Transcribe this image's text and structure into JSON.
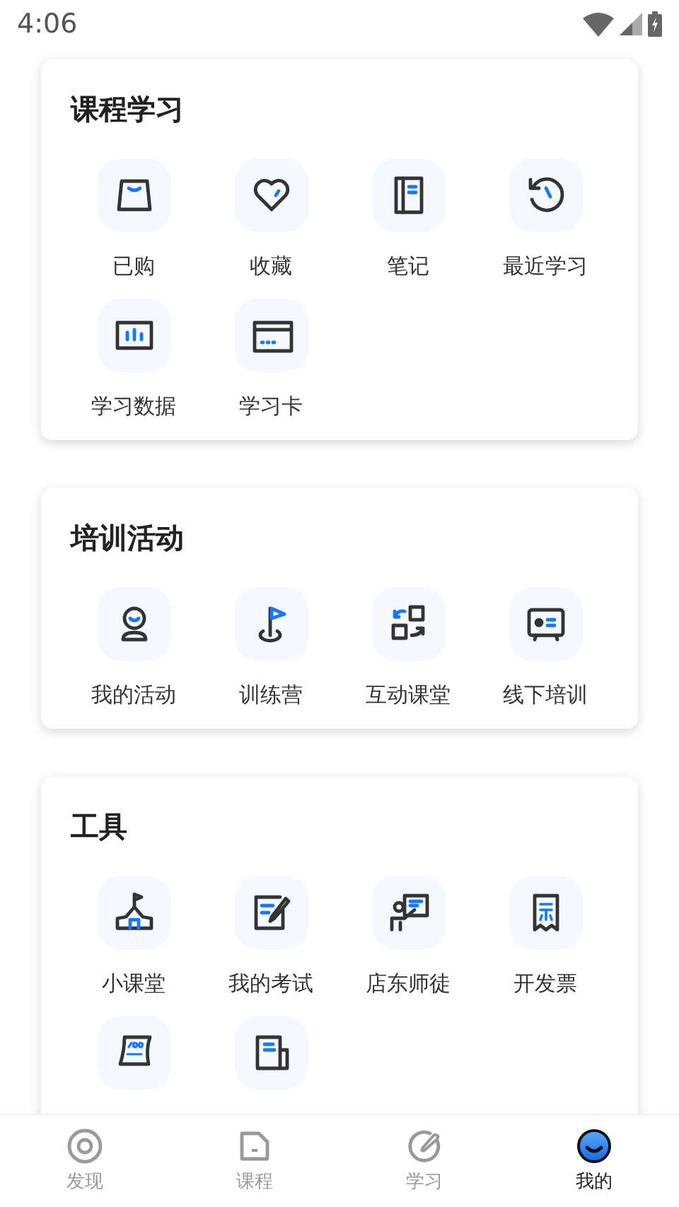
{
  "status_bar": {
    "time": "4:06"
  },
  "sections": [
    {
      "title": "课程学习",
      "items": [
        {
          "label": "已购"
        },
        {
          "label": "收藏"
        },
        {
          "label": "笔记"
        },
        {
          "label": "最近学习"
        },
        {
          "label": "学习数据"
        },
        {
          "label": "学习卡"
        }
      ]
    },
    {
      "title": "培训活动",
      "items": [
        {
          "label": "我的活动"
        },
        {
          "label": "训练营"
        },
        {
          "label": "互动课堂"
        },
        {
          "label": "线下培训"
        }
      ]
    },
    {
      "title": "工具",
      "items": [
        {
          "kind": "labeled",
          "label": "小课堂"
        },
        {
          "kind": "labeled",
          "label": "我的考试"
        },
        {
          "kind": "labeled",
          "label": "店东师徒"
        },
        {
          "kind": "labeled",
          "label": "开发票"
        },
        {
          "kind": "icon_only"
        },
        {
          "kind": "icon_only"
        }
      ]
    }
  ],
  "tab_bar": [
    {
      "label": "发现",
      "selected": false
    },
    {
      "label": "课程",
      "selected": false
    },
    {
      "label": "学习",
      "selected": false
    },
    {
      "label": "我的",
      "selected": true
    }
  ]
}
